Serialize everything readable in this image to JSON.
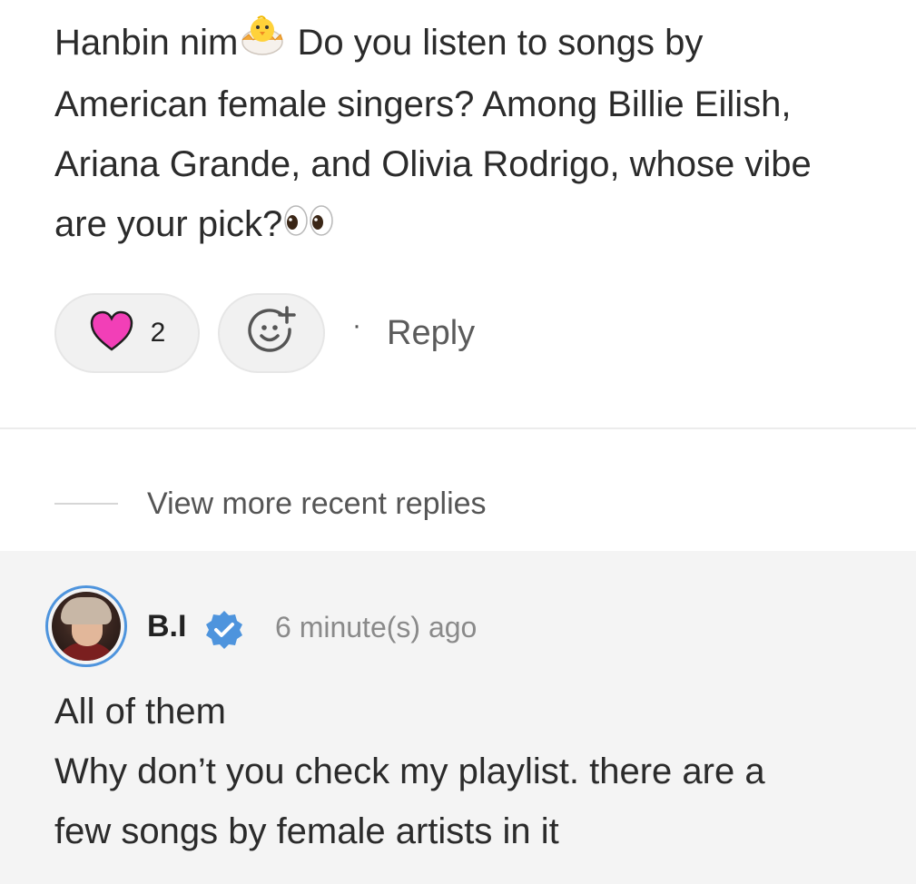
{
  "post": {
    "line1_a": "Hanbin nim",
    "line1_b": " Do you listen to songs by",
    "line2": "American female singers? Among Billie Eilish,",
    "line3": "Ariana Grande, and Olivia Rodrigo, whose vibe",
    "line4": "are your pick?",
    "emoji_1": "hatching-chick-icon",
    "emoji_2": "eyes-icon"
  },
  "actions": {
    "like_count": "2",
    "dot": "·",
    "reply_label": "Reply",
    "heart_color": "#f23fb7"
  },
  "thread": {
    "view_more": "View more recent replies"
  },
  "reply": {
    "author": "B.I",
    "time": "6 minute(s) ago",
    "lines": [
      "All of them",
      "Why don’t you check my playlist. there are a",
      "few songs by female artists in it"
    ],
    "verified_color": "#4e94dd",
    "ring_color": "#4e94dd"
  }
}
